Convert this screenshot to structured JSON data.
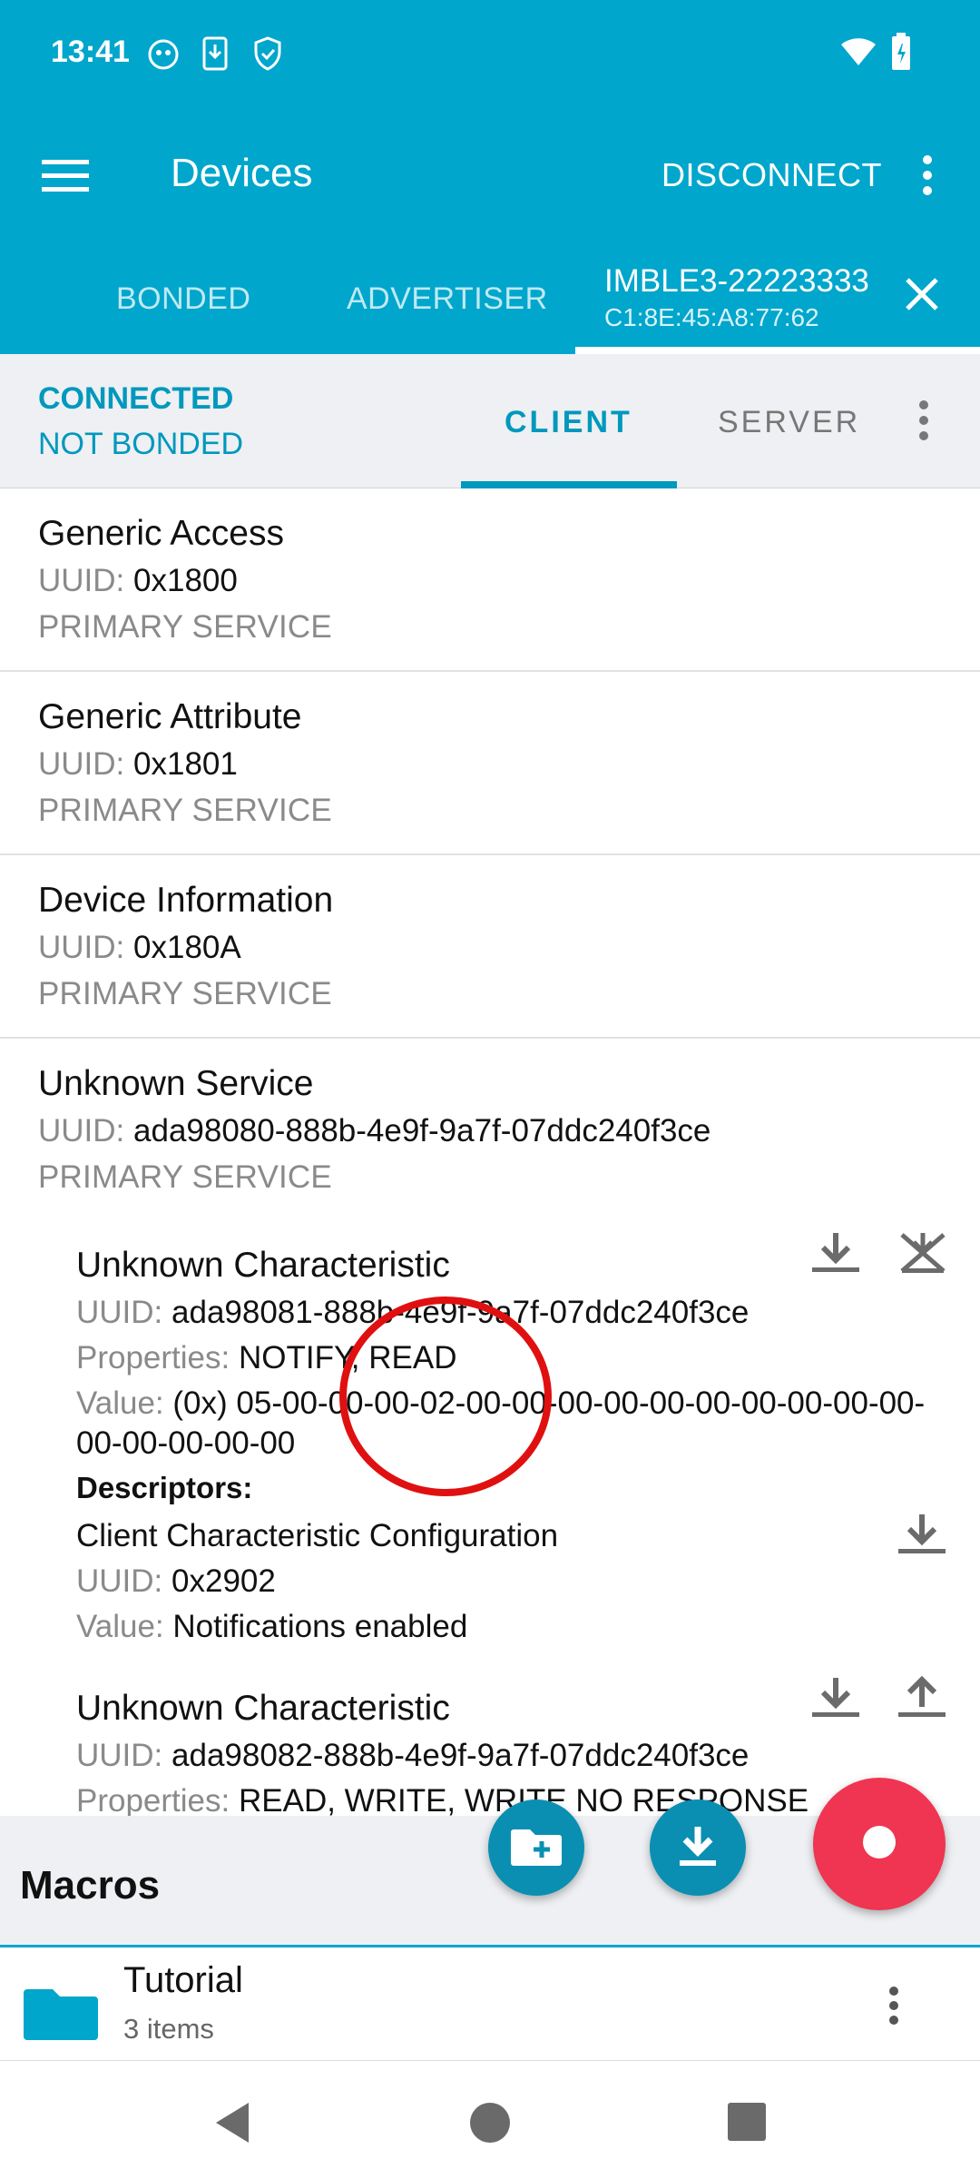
{
  "status": {
    "time": "13:41"
  },
  "appbar": {
    "title": "Devices",
    "action": "DISCONNECT"
  },
  "tabs": {
    "bonded": "BONDED",
    "advertiser": "ADVERTISER",
    "device_name": "IMBLE3-22223333",
    "device_mac": "C1:8E:45:A8:77:62"
  },
  "connection": {
    "state": "CONNECTED",
    "bond": "NOT BONDED",
    "tab_client": "CLIENT",
    "tab_server": "SERVER"
  },
  "labels": {
    "uuid": "UUID:",
    "properties": "Properties:",
    "value": "Value:",
    "primary": "PRIMARY SERVICE",
    "descriptors": "Descriptors:"
  },
  "services": [
    {
      "name": "Generic Access",
      "uuid": "0x1800"
    },
    {
      "name": "Generic Attribute",
      "uuid": "0x1801"
    },
    {
      "name": "Device Information",
      "uuid": "0x180A"
    },
    {
      "name": "Unknown Service",
      "uuid": "ada98080-888b-4e9f-9a7f-07ddc240f3ce"
    }
  ],
  "characteristics": [
    {
      "name": "Unknown Characteristic",
      "uuid": "ada98081-888b-4e9f-9a7f-07ddc240f3ce",
      "properties": "NOTIFY, READ",
      "value_line1": "(0x) 05-00-00-00-02-00-00-00-00-00-00-00-00-00-00-",
      "value_line2": "00-00-00-00-00"
    },
    {
      "name": "Unknown Characteristic",
      "uuid": "ada98082-888b-4e9f-9a7f-07ddc240f3ce",
      "properties": "READ, WRITE, WRITE NO RESPONSE"
    }
  ],
  "descriptor": {
    "name": "Client Characteristic Configuration",
    "uuid": "0x2902",
    "value": "Notifications enabled"
  },
  "macros": {
    "title": "Macros",
    "folder_name": "Tutorial",
    "folder_count": "3 items"
  },
  "colors": {
    "primary": "#00a6cc",
    "record": "#ef3551",
    "annotation": "#e01010"
  },
  "icons": [
    "menu-icon",
    "more-vert-icon",
    "close-icon",
    "download-icon",
    "notify-off-icon",
    "upload-icon",
    "new-folder-icon",
    "record-icon",
    "folder-icon",
    "back-icon",
    "home-icon",
    "recents-icon"
  ]
}
